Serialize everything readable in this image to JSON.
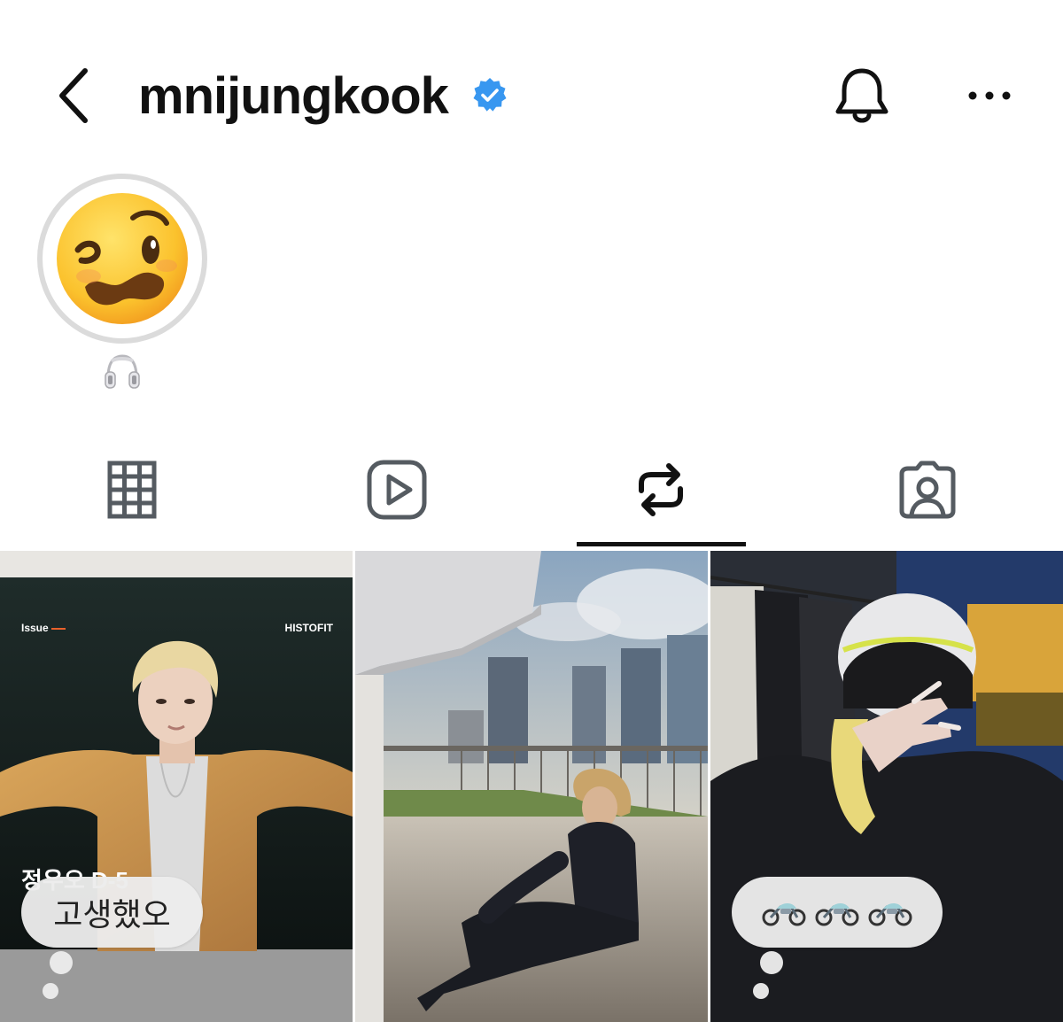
{
  "header": {
    "username": "mnijungkook",
    "verified": true,
    "icons": {
      "back": "chevron-left-icon",
      "bell": "bell-icon",
      "more": "more-horizontal-icon"
    }
  },
  "profile": {
    "avatar": "woozy-face-emoji",
    "note_icon": "headphones-icon"
  },
  "tabs": [
    {
      "icon": "grid-icon",
      "active": false
    },
    {
      "icon": "reels-icon",
      "active": false
    },
    {
      "icon": "repost-icon",
      "active": true
    },
    {
      "icon": "tagged-icon",
      "active": false
    }
  ],
  "posts": [
    {
      "magazine": {
        "issue": "Issue",
        "brand": "HISTOFIT",
        "korean": "정우오 D-5"
      },
      "note": "고생했오"
    },
    {
      "note": ""
    },
    {
      "note_icons": [
        "motorcycle-icon",
        "motorcycle-icon",
        "motorcycle-icon"
      ]
    }
  ],
  "colors": {
    "verified_blue": "#3897f0",
    "icon_gray": "#555b61",
    "text": "#111111"
  }
}
